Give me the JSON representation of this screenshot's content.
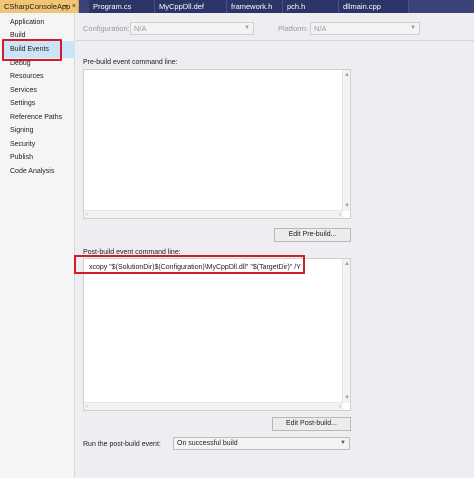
{
  "tabs": [
    {
      "label": "CSharpConsoleApp",
      "active": true
    },
    {
      "label": "Program.cs",
      "active": false
    },
    {
      "label": "MyCppDll.def",
      "active": false
    },
    {
      "label": "framework.h",
      "active": false
    },
    {
      "label": "pch.h",
      "active": false
    },
    {
      "label": "dllmain.cpp",
      "active": false
    }
  ],
  "tab_pin_icon": "⊸",
  "tab_close_icon": "×",
  "nav": {
    "items": [
      "Application",
      "Build",
      "Build Events",
      "Debug",
      "Resources",
      "Services",
      "Settings",
      "Reference Paths",
      "Signing",
      "Security",
      "Publish",
      "Code Analysis"
    ],
    "selected": "Build Events"
  },
  "config": {
    "configuration_label": "Configuration:",
    "configuration_value": "N/A",
    "platform_label": "Platform:",
    "platform_value": "N/A"
  },
  "prebuild": {
    "label": "Pre-build event command line:",
    "value": "",
    "edit_button": "Edit Pre-build..."
  },
  "postbuild": {
    "label": "Post-build event command line:",
    "value": "xcopy \"$(SolutionDir)$(Configuration)\\MyCppDll.dll\" \"$(TargetDir)\" /Y",
    "edit_button": "Edit Post-build..."
  },
  "run": {
    "label": "Run the post-build event:",
    "value": "On successful build"
  },
  "colors": {
    "tab_active": "#f0c676",
    "tab_bar": "#3b4378",
    "highlight": "#d11d27",
    "nav_selected": "#cce4f7"
  }
}
